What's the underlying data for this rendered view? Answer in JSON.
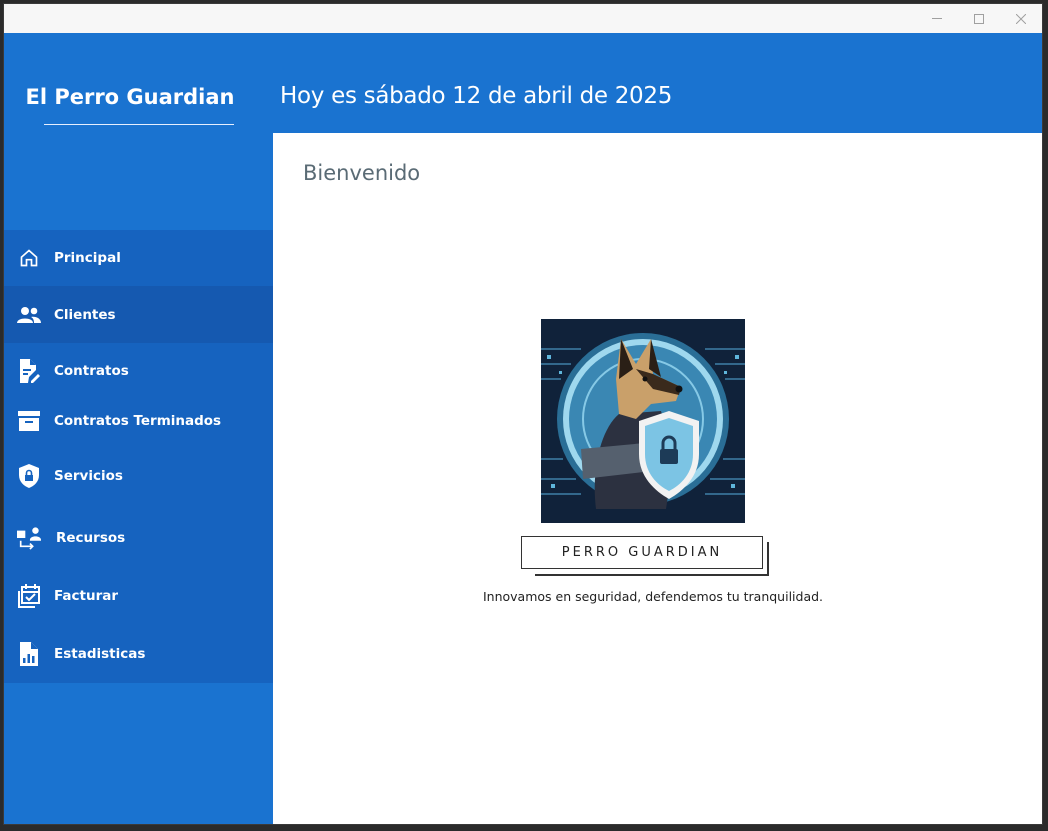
{
  "window": {
    "controls": [
      "minimize-icon",
      "maximize-icon",
      "close-icon"
    ]
  },
  "sidebar": {
    "brand": "El Perro Guardian",
    "items": [
      {
        "label": "Principal",
        "icon": "home-icon"
      },
      {
        "label": "Clientes",
        "icon": "users-icon",
        "active": true
      },
      {
        "label": "Contratos",
        "icon": "document-edit-icon"
      },
      {
        "label": "Contratos Terminados",
        "icon": "archive-icon"
      },
      {
        "label": "Servicios",
        "icon": "shield-lock-icon"
      },
      {
        "label": "Recursos",
        "icon": "resources-icon"
      },
      {
        "label": "Facturar",
        "icon": "calendar-check-icon"
      },
      {
        "label": "Estadisticas",
        "icon": "chart-file-icon"
      }
    ]
  },
  "header": {
    "date": "Hoy es sábado 12 de abril de 2025"
  },
  "main": {
    "welcome": "Bienvenido",
    "logo_text": "PERRO GUARDIAN",
    "slogan": "Innovamos en seguridad, defendemos tu tranquilidad."
  },
  "colors": {
    "primary": "#1a73d0",
    "menu_bg": "#1663bf",
    "menu_active": "#1559b0",
    "welcome_text": "#5a6b75"
  }
}
